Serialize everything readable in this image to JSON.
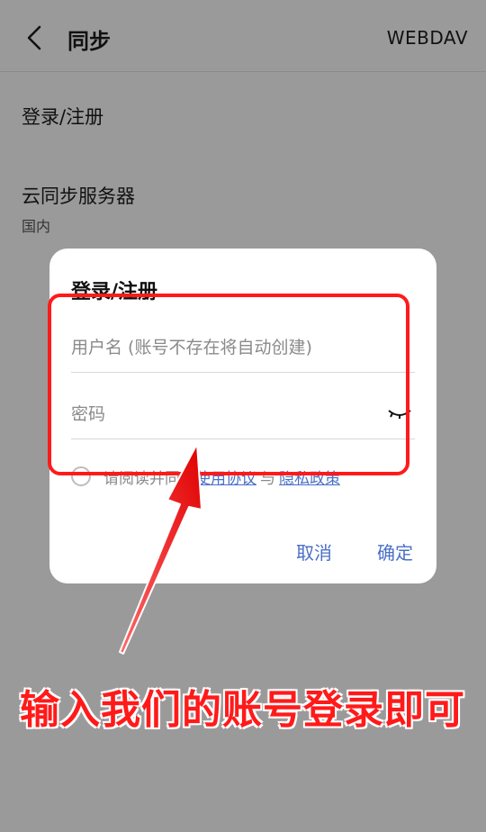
{
  "header": {
    "title": "同步",
    "action_label": "WEBDAV"
  },
  "settings": {
    "login_label": "登录/注册",
    "server_label": "云同步服务器",
    "server_value": "国内"
  },
  "dialog": {
    "title": "登录/注册",
    "username_placeholder": "用户名 (账号不存在将自动创建)",
    "password_placeholder": "密码",
    "agree_text": "请阅读并同意",
    "terms_link": "使用协议",
    "and_text": "与",
    "privacy_link": "隐私政策",
    "cancel_label": "取消",
    "confirm_label": "确定"
  },
  "annotation": {
    "caption": "输入我们的账号登录即可",
    "color": "#ff1a1a"
  },
  "colors": {
    "overlay_bg": "#9a9a9a",
    "accent": "#4a6fc6"
  }
}
